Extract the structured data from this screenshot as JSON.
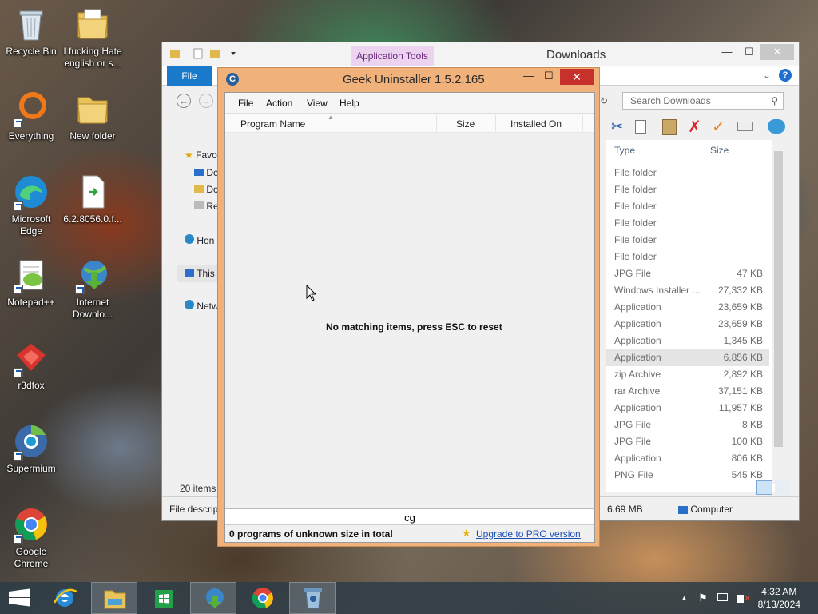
{
  "desktop": {
    "icons": [
      {
        "label": "Recycle Bin"
      },
      {
        "label": "I fucking Hate english or s..."
      },
      {
        "label": "Everything"
      },
      {
        "label": "New folder"
      },
      {
        "label": "Microsoft Edge"
      },
      {
        "label": "6.2.8056.0.f..."
      },
      {
        "label": "Notepad++"
      },
      {
        "label": "Internet Downlo..."
      },
      {
        "label": "r3dfox"
      },
      {
        "label": "Supermium"
      },
      {
        "label": "Google Chrome"
      }
    ]
  },
  "explorer": {
    "title": "Downloads",
    "contextual_tab": "Application Tools",
    "file_tab": "File",
    "search_placeholder": "Search Downloads",
    "sidebar": [
      "Favo",
      "De",
      "Do",
      "Re",
      "Hon",
      "This",
      "Netw"
    ],
    "columns": {
      "type": "Type",
      "size": "Size"
    },
    "rows": [
      {
        "type": "File folder",
        "size": ""
      },
      {
        "type": "File folder",
        "size": ""
      },
      {
        "type": "File folder",
        "size": ""
      },
      {
        "type": "File folder",
        "size": ""
      },
      {
        "type": "File folder",
        "size": ""
      },
      {
        "type": "File folder",
        "size": ""
      },
      {
        "type": "JPG File",
        "size": "47 KB"
      },
      {
        "type": "Windows Installer ...",
        "size": "27,332 KB"
      },
      {
        "type": "Application",
        "size": "23,659 KB"
      },
      {
        "type": "Application",
        "size": "23,659 KB"
      },
      {
        "type": "Application",
        "size": "1,345 KB"
      },
      {
        "type": "Application",
        "size": "6,856 KB",
        "selected": true
      },
      {
        "type": "zip Archive",
        "size": "2,892 KB"
      },
      {
        "type": "rar Archive",
        "size": "37,151 KB"
      },
      {
        "type": "Application",
        "size": "11,957 KB"
      },
      {
        "type": "JPG File",
        "size": "8 KB"
      },
      {
        "type": "JPG File",
        "size": "100 KB"
      },
      {
        "type": "Application",
        "size": "806 KB"
      },
      {
        "type": "PNG File",
        "size": "545 KB"
      }
    ],
    "item_count": "20 items",
    "status": {
      "left": "File descript",
      "size": "6.69 MB",
      "computer": "Computer"
    }
  },
  "geek": {
    "title": "Geek Uninstaller 1.5.2.165",
    "menu": [
      "File",
      "Action",
      "View",
      "Help"
    ],
    "columns": {
      "name": "Program Name",
      "size": "Size",
      "installed": "Installed On"
    },
    "empty_message": "No matching items, press ESC to reset",
    "filter_text": "cg",
    "status_left": "0 programs of unknown size in total",
    "pro_link": "Upgrade to PRO version"
  },
  "taskbar": {
    "time": "4:32 AM",
    "date": "8/13/2024"
  }
}
